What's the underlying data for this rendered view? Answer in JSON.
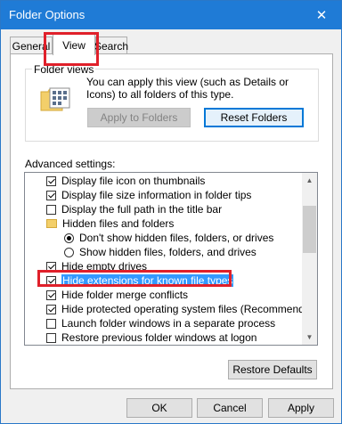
{
  "window": {
    "title": "Folder Options",
    "close_glyph": "✕"
  },
  "tabs": [
    {
      "label": "General"
    },
    {
      "label": "View"
    },
    {
      "label": "Search"
    }
  ],
  "folder_views": {
    "group_label": "Folder views",
    "description": "You can apply this view (such as Details or Icons) to all folders of this type.",
    "apply_button": "Apply to Folders",
    "reset_button": "Reset Folders"
  },
  "advanced": {
    "label": "Advanced settings:",
    "items": [
      {
        "type": "checkbox",
        "checked": true,
        "label": "Display file icon on thumbnails"
      },
      {
        "type": "checkbox",
        "checked": true,
        "label": "Display file size information in folder tips"
      },
      {
        "type": "checkbox",
        "checked": false,
        "label": "Display the full path in the title bar"
      },
      {
        "type": "folder",
        "label": "Hidden files and folders"
      },
      {
        "type": "radio",
        "checked": true,
        "label": "Don't show hidden files, folders, or drives"
      },
      {
        "type": "radio",
        "checked": false,
        "label": "Show hidden files, folders, and drives"
      },
      {
        "type": "checkbox",
        "checked": true,
        "label": "Hide empty drives"
      },
      {
        "type": "checkbox",
        "checked": true,
        "label": "Hide extensions for known file types",
        "selected": true
      },
      {
        "type": "checkbox",
        "checked": true,
        "label": "Hide folder merge conflicts"
      },
      {
        "type": "checkbox",
        "checked": true,
        "label": "Hide protected operating system files (Recommended)"
      },
      {
        "type": "checkbox",
        "checked": false,
        "label": "Launch folder windows in a separate process"
      },
      {
        "type": "checkbox",
        "checked": false,
        "label": "Restore previous folder windows at logon"
      }
    ],
    "restore_button": "Restore Defaults"
  },
  "footer": {
    "ok": "OK",
    "cancel": "Cancel",
    "apply": "Apply"
  },
  "colors": {
    "titlebar": "#1f7bd6",
    "selection": "#3399ff",
    "annotation_red": "#e0202a"
  }
}
